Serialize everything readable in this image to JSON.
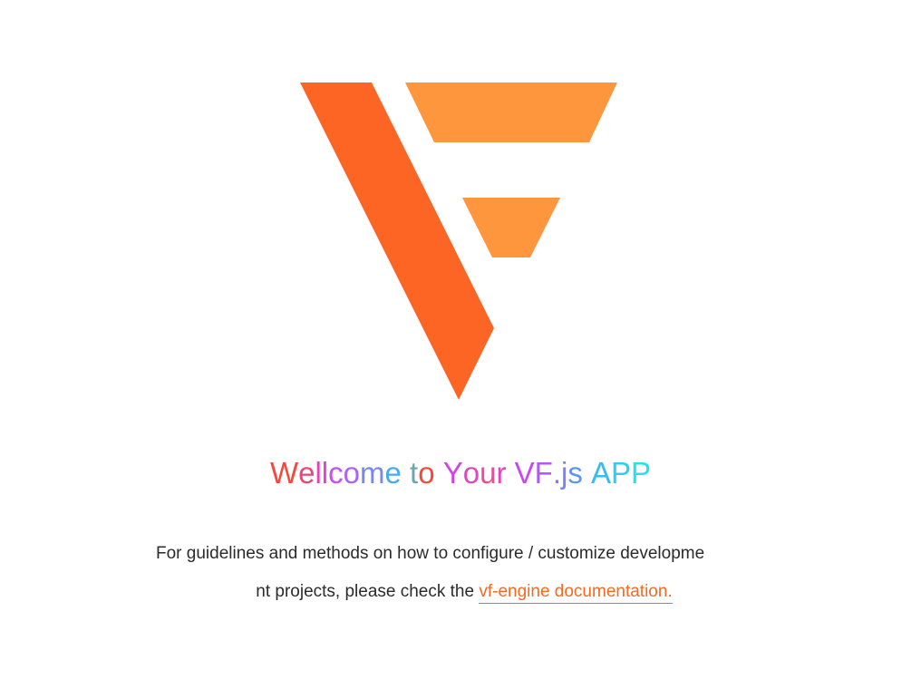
{
  "logo": {
    "name": "vf-logo",
    "colors": {
      "primary": "#fd6525",
      "secondary": "#fe963d"
    }
  },
  "title": {
    "text": "Wellcome to Your VF.js APP",
    "gradient_colors": [
      "#f24a3c",
      "#e83bd1",
      "#b657f0",
      "#6b8cf6",
      "#36c8f0",
      "#f24a3c",
      "#c946e6",
      "#e55b9e",
      "#d33cf0",
      "#a46cf5",
      "#49a8f5",
      "#26e0f0"
    ]
  },
  "description": {
    "line1": "For guidelines and methods on how to configure / customize developme",
    "line2_prefix": "nt projects, please check the ",
    "link_text": "vf-engine documentation.",
    "link_color": "#f26a23"
  }
}
